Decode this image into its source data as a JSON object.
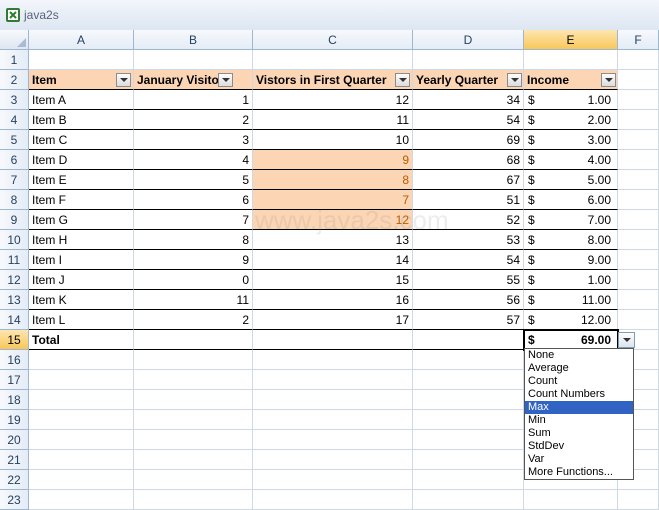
{
  "window": {
    "title": "java2s"
  },
  "columns": [
    "A",
    "B",
    "C",
    "D",
    "E",
    "F"
  ],
  "selected_column": "E",
  "selected_row": 15,
  "table_header": {
    "item": "Item",
    "january": "January Visitors",
    "first_quarter": "Vistors in First Quarter",
    "yearly": "Yearly Quarter",
    "income": "Income"
  },
  "rows": [
    {
      "n": 3,
      "item": "Item A",
      "jan": "1",
      "fq": "12",
      "yearly": "34",
      "income": "1.00",
      "hl": false
    },
    {
      "n": 4,
      "item": "Item B",
      "jan": "2",
      "fq": "11",
      "yearly": "54",
      "income": "2.00",
      "hl": false
    },
    {
      "n": 5,
      "item": "Item C",
      "jan": "3",
      "fq": "10",
      "yearly": "69",
      "income": "3.00",
      "hl": false
    },
    {
      "n": 6,
      "item": "Item D",
      "jan": "4",
      "fq": "9",
      "yearly": "68",
      "income": "4.00",
      "hl": true
    },
    {
      "n": 7,
      "item": "Item E",
      "jan": "5",
      "fq": "8",
      "yearly": "67",
      "income": "5.00",
      "hl": true
    },
    {
      "n": 8,
      "item": "Item F",
      "jan": "6",
      "fq": "7",
      "yearly": "51",
      "income": "6.00",
      "hl": true
    },
    {
      "n": 9,
      "item": "Item G",
      "jan": "7",
      "fq": "12",
      "yearly": "52",
      "income": "7.00",
      "hl": true
    },
    {
      "n": 10,
      "item": "Item H",
      "jan": "8",
      "fq": "13",
      "yearly": "53",
      "income": "8.00",
      "hl": false
    },
    {
      "n": 11,
      "item": "Item I",
      "jan": "9",
      "fq": "14",
      "yearly": "54",
      "income": "9.00",
      "hl": false
    },
    {
      "n": 12,
      "item": "Item J",
      "jan": "0",
      "fq": "15",
      "yearly": "55",
      "income": "1.00",
      "hl": false
    },
    {
      "n": 13,
      "item": "Item K",
      "jan": "11",
      "fq": "16",
      "yearly": "56",
      "income": "11.00",
      "hl": false
    },
    {
      "n": 14,
      "item": "Item L",
      "jan": "2",
      "fq": "17",
      "yearly": "57",
      "income": "12.00",
      "hl": false
    }
  ],
  "total": {
    "label": "Total",
    "currency": "$",
    "income": "69.00"
  },
  "currency_symbol": "$",
  "total_function_menu": {
    "options": [
      "None",
      "Average",
      "Count",
      "Count Numbers",
      "Max",
      "Min",
      "Sum",
      "StdDev",
      "Var",
      "More Functions..."
    ],
    "highlighted": "Max"
  },
  "watermark": "www.java2s.com"
}
